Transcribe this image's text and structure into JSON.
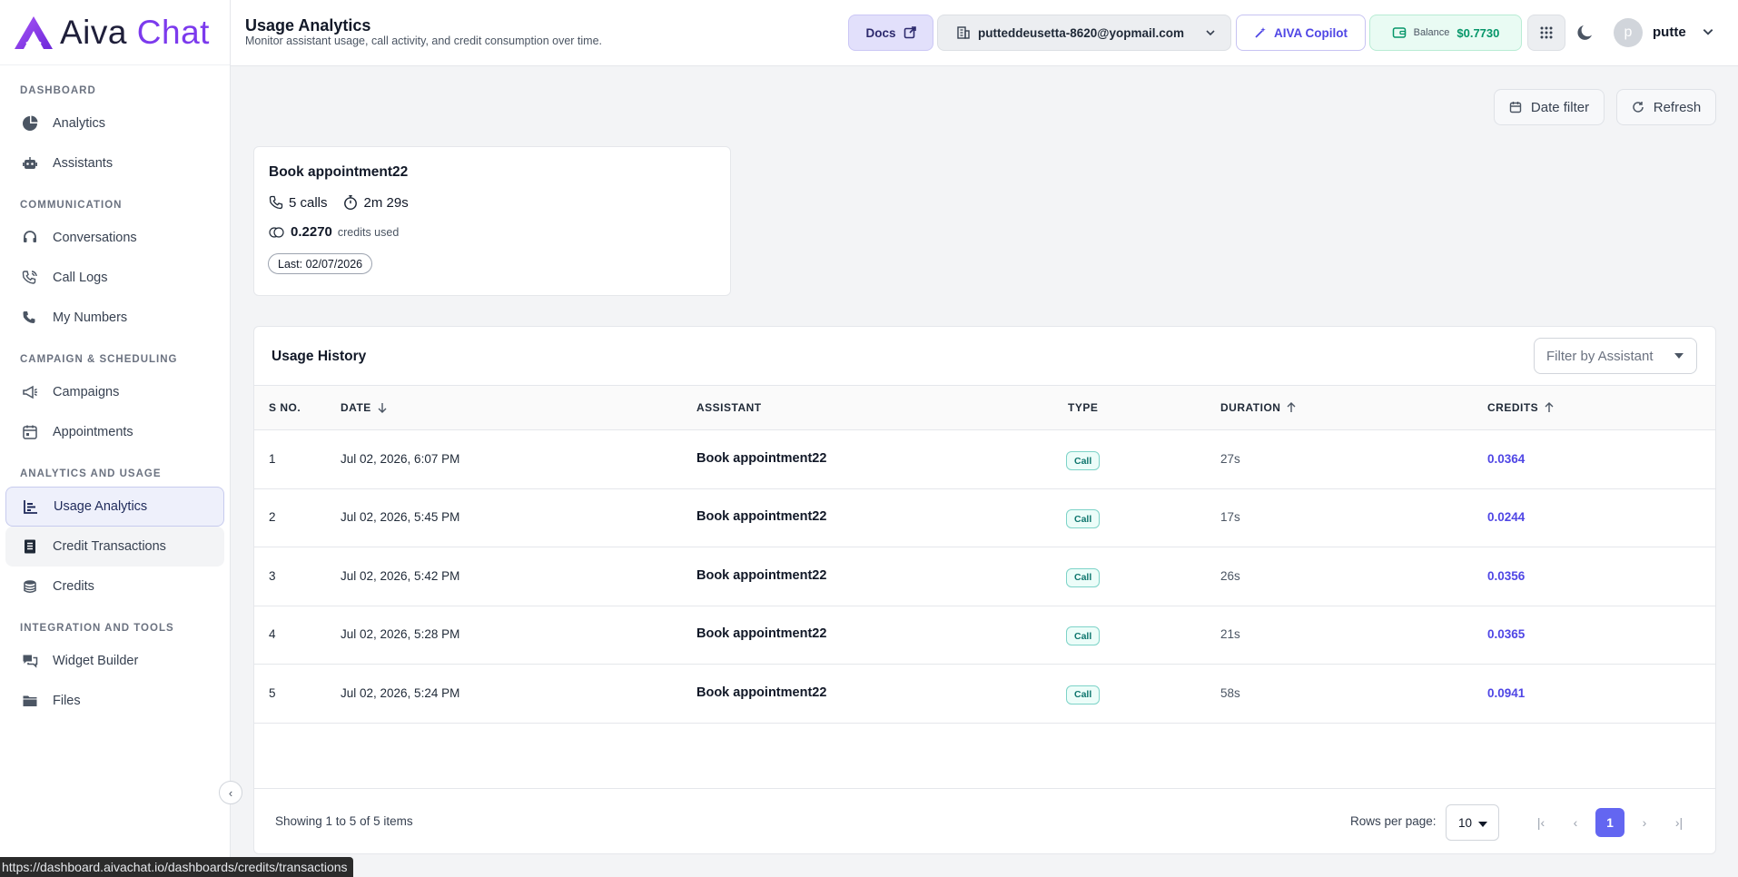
{
  "app": {
    "logo_part1": "Aiva",
    "logo_part2": "Chat"
  },
  "sidebar": {
    "sections": [
      {
        "title": "DASHBOARD",
        "items": [
          {
            "label": "Analytics",
            "icon": "pie-chart-icon"
          },
          {
            "label": "Assistants",
            "icon": "robot-icon"
          }
        ]
      },
      {
        "title": "COMMUNICATION",
        "items": [
          {
            "label": "Conversations",
            "icon": "headset-icon"
          },
          {
            "label": "Call Logs",
            "icon": "phone-log-icon"
          },
          {
            "label": "My Numbers",
            "icon": "phone-icon"
          }
        ]
      },
      {
        "title": "CAMPAIGN & SCHEDULING",
        "items": [
          {
            "label": "Campaigns",
            "icon": "megaphone-icon"
          },
          {
            "label": "Appointments",
            "icon": "calendar-icon"
          }
        ]
      },
      {
        "title": "ANALYTICS AND USAGE",
        "items": [
          {
            "label": "Usage Analytics",
            "icon": "bar-chart-icon",
            "active": true
          },
          {
            "label": "Credit Transactions",
            "icon": "receipt-icon",
            "hover": true
          },
          {
            "label": "Credits",
            "icon": "coins-icon"
          }
        ]
      },
      {
        "title": "INTEGRATION AND TOOLS",
        "items": [
          {
            "label": "Widget Builder",
            "icon": "chat-bubbles-icon"
          },
          {
            "label": "Files",
            "icon": "folder-icon"
          }
        ]
      }
    ]
  },
  "header": {
    "title": "Usage Analytics",
    "subtitle": "Monitor assistant usage, call activity, and credit consumption over time.",
    "docs_label": "Docs",
    "account_email": "putteddeusetta-8620@yopmail.com",
    "copilot_label": "AIVA Copilot",
    "balance_label": "Balance",
    "balance_value": "$0.7730",
    "avatar_initial": "p",
    "username": "putte"
  },
  "toolbar": {
    "date_filter": "Date filter",
    "refresh": "Refresh"
  },
  "summary_card": {
    "title": "Book appointment22",
    "calls": "5 calls",
    "duration": "2m 29s",
    "credits_value": "0.2270",
    "credits_label": "credits used",
    "last": "Last: 02/07/2026"
  },
  "usage_history": {
    "title": "Usage History",
    "filter_placeholder": "Filter by Assistant",
    "columns": {
      "sno": "S NO.",
      "date": "DATE",
      "assistant": "ASSISTANT",
      "type": "TYPE",
      "duration": "DURATION",
      "credits": "CREDITS"
    },
    "rows": [
      {
        "sno": "1",
        "date": "Jul 02, 2026, 6:07 PM",
        "assistant": "Book appointment22",
        "type": "Call",
        "duration": "27s",
        "credits": "0.0364"
      },
      {
        "sno": "2",
        "date": "Jul 02, 2026, 5:45 PM",
        "assistant": "Book appointment22",
        "type": "Call",
        "duration": "17s",
        "credits": "0.0244"
      },
      {
        "sno": "3",
        "date": "Jul 02, 2026, 5:42 PM",
        "assistant": "Book appointment22",
        "type": "Call",
        "duration": "26s",
        "credits": "0.0356"
      },
      {
        "sno": "4",
        "date": "Jul 02, 2026, 5:28 PM",
        "assistant": "Book appointment22",
        "type": "Call",
        "duration": "21s",
        "credits": "0.0365"
      },
      {
        "sno": "5",
        "date": "Jul 02, 2026, 5:24 PM",
        "assistant": "Book appointment22",
        "type": "Call",
        "duration": "58s",
        "credits": "0.0941"
      }
    ],
    "footer": {
      "showing": "Showing 1 to 5 of 5 items",
      "rows_per_page_label": "Rows per page:",
      "rows_per_page": "10",
      "current_page": "1"
    }
  },
  "status_url": "https://dashboard.aivachat.io/dashboards/credits/transactions",
  "colors": {
    "accent": "#6366f1",
    "brand_purple": "#7c3aed",
    "balance_green": "#059669"
  }
}
